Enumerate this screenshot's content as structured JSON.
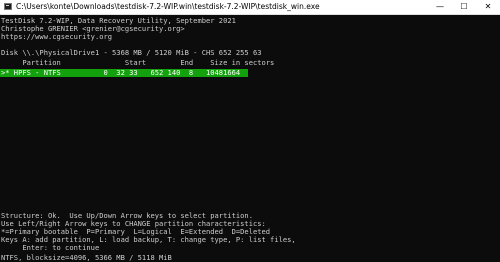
{
  "window": {
    "title": "C:\\Users\\konte\\Downloads\\testdisk-7.2-WIP.win\\testdisk-7.2-WIP\\testdisk_win.exe",
    "minimize_glyph": "—",
    "maximize_glyph": "☐",
    "close_glyph": "✕"
  },
  "console": {
    "header": [
      "TestDisk 7.2-WIP, Data Recovery Utility, September 2021",
      "Christophe GRENIER <grenier@cgsecurity.org>",
      "https://www.cgsecurity.org"
    ],
    "disk_line": "Disk \\\\.\\PhysicalDrive1 - 5368 MB / 5120 MiB - CHS 652 255 63",
    "table_header": "     Partition               Start        End    Size in sectors",
    "partitions": [
      {
        "text": ">* HPFS - NTFS          0  32 33   652 140  8   10481664",
        "selected": true
      }
    ],
    "footer": [
      "Structure: Ok.  Use Up/Down Arrow keys to select partition.",
      "Use Left/Right Arrow keys to CHANGE partition characteristics:",
      "*=Primary bootable  P=Primary  L=Logical  E=Extended  D=Deleted",
      "Keys A: add partition, L: load backup, T: change type, P: list files,",
      "     Enter: to continue",
      "NTFS, blocksize=4096, 5366 MB / 5118 MiB"
    ]
  },
  "colors": {
    "console_bg": "#0c0c0c",
    "console_fg": "#cccccc",
    "selection_bg": "#13a10e"
  }
}
